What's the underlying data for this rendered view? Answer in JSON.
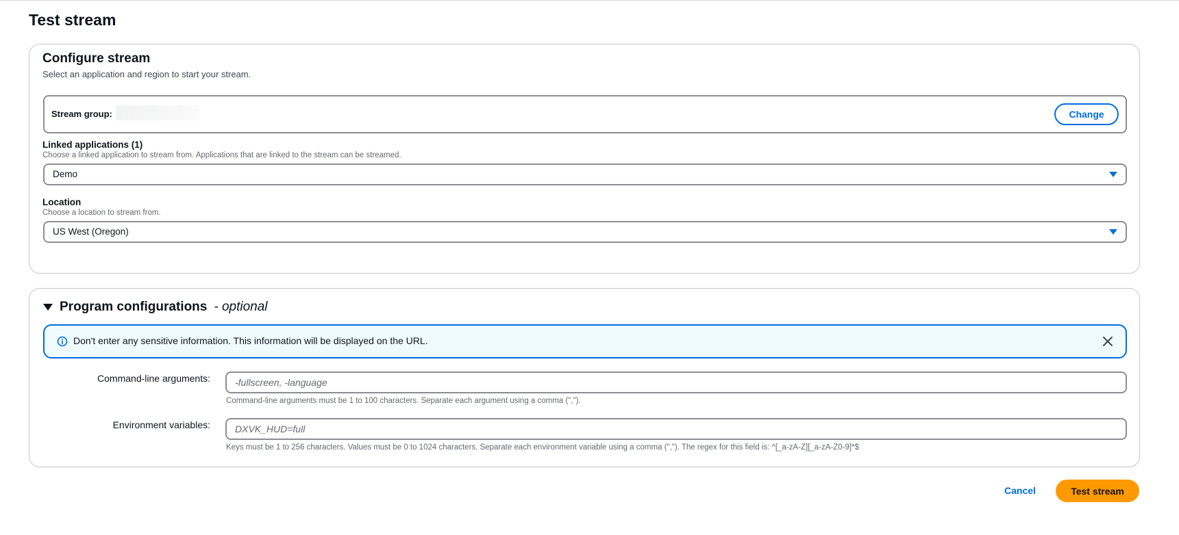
{
  "page": {
    "title": "Test stream"
  },
  "configure": {
    "title": "Configure stream",
    "description": "Select an application and region to start your stream.",
    "stream_group": {
      "label": "Stream group:",
      "change_label": "Change"
    },
    "linked_apps": {
      "label": "Linked applications (1)",
      "help": "Choose a linked application to stream from. Applications that are linked to the stream can be streamed.",
      "selected": "Demo"
    },
    "location": {
      "label": "Location",
      "help": "Choose a location to stream from.",
      "selected": "US West (Oregon)"
    }
  },
  "program": {
    "title": "Program configurations",
    "optional": "- optional",
    "alert": "Don't enter any sensitive information. This information will be displayed on the URL.",
    "cmd_args": {
      "label": "Command-line arguments:",
      "placeholder": "-fullscreen, -language",
      "help": "Command-line arguments must be 1 to 100 characters. Separate each argument using a comma (\",\")."
    },
    "env_vars": {
      "label": "Environment variables:",
      "placeholder": "DXVK_HUD=full",
      "help": "Keys must be 1 to 256 characters. Values must be 0 to 1024 characters. Separate each environment variable using a comma (\",\"). The regex for this field is: ^[_a-zA-Z][_a-zA-Z0-9]*$"
    }
  },
  "footer": {
    "cancel_label": "Cancel",
    "submit_label": "Test stream"
  },
  "colors": {
    "primary": "#ff9900",
    "link": "#006ce0",
    "alert_bg": "#f0fbff"
  }
}
